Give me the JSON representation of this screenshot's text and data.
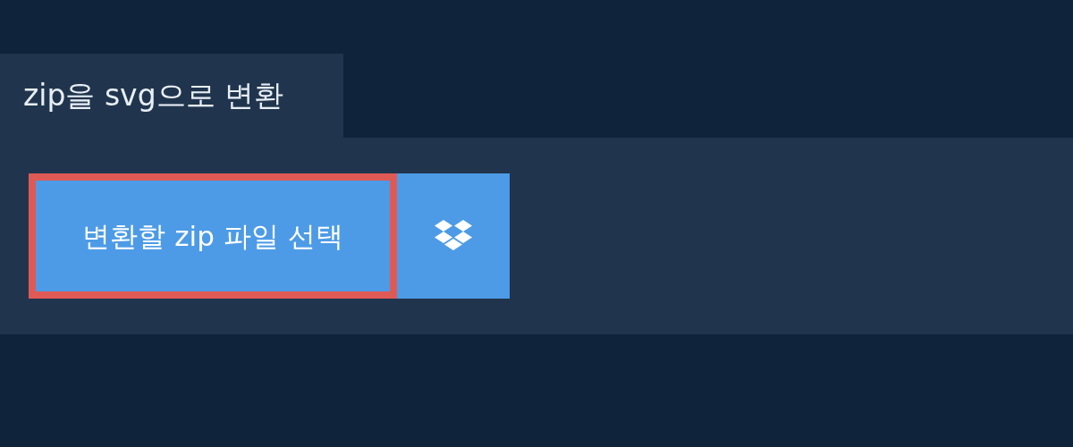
{
  "title": "zip을 svg으로 변환",
  "upload_button": {
    "label": "변환할 zip 파일 선택",
    "focused": true
  }
}
